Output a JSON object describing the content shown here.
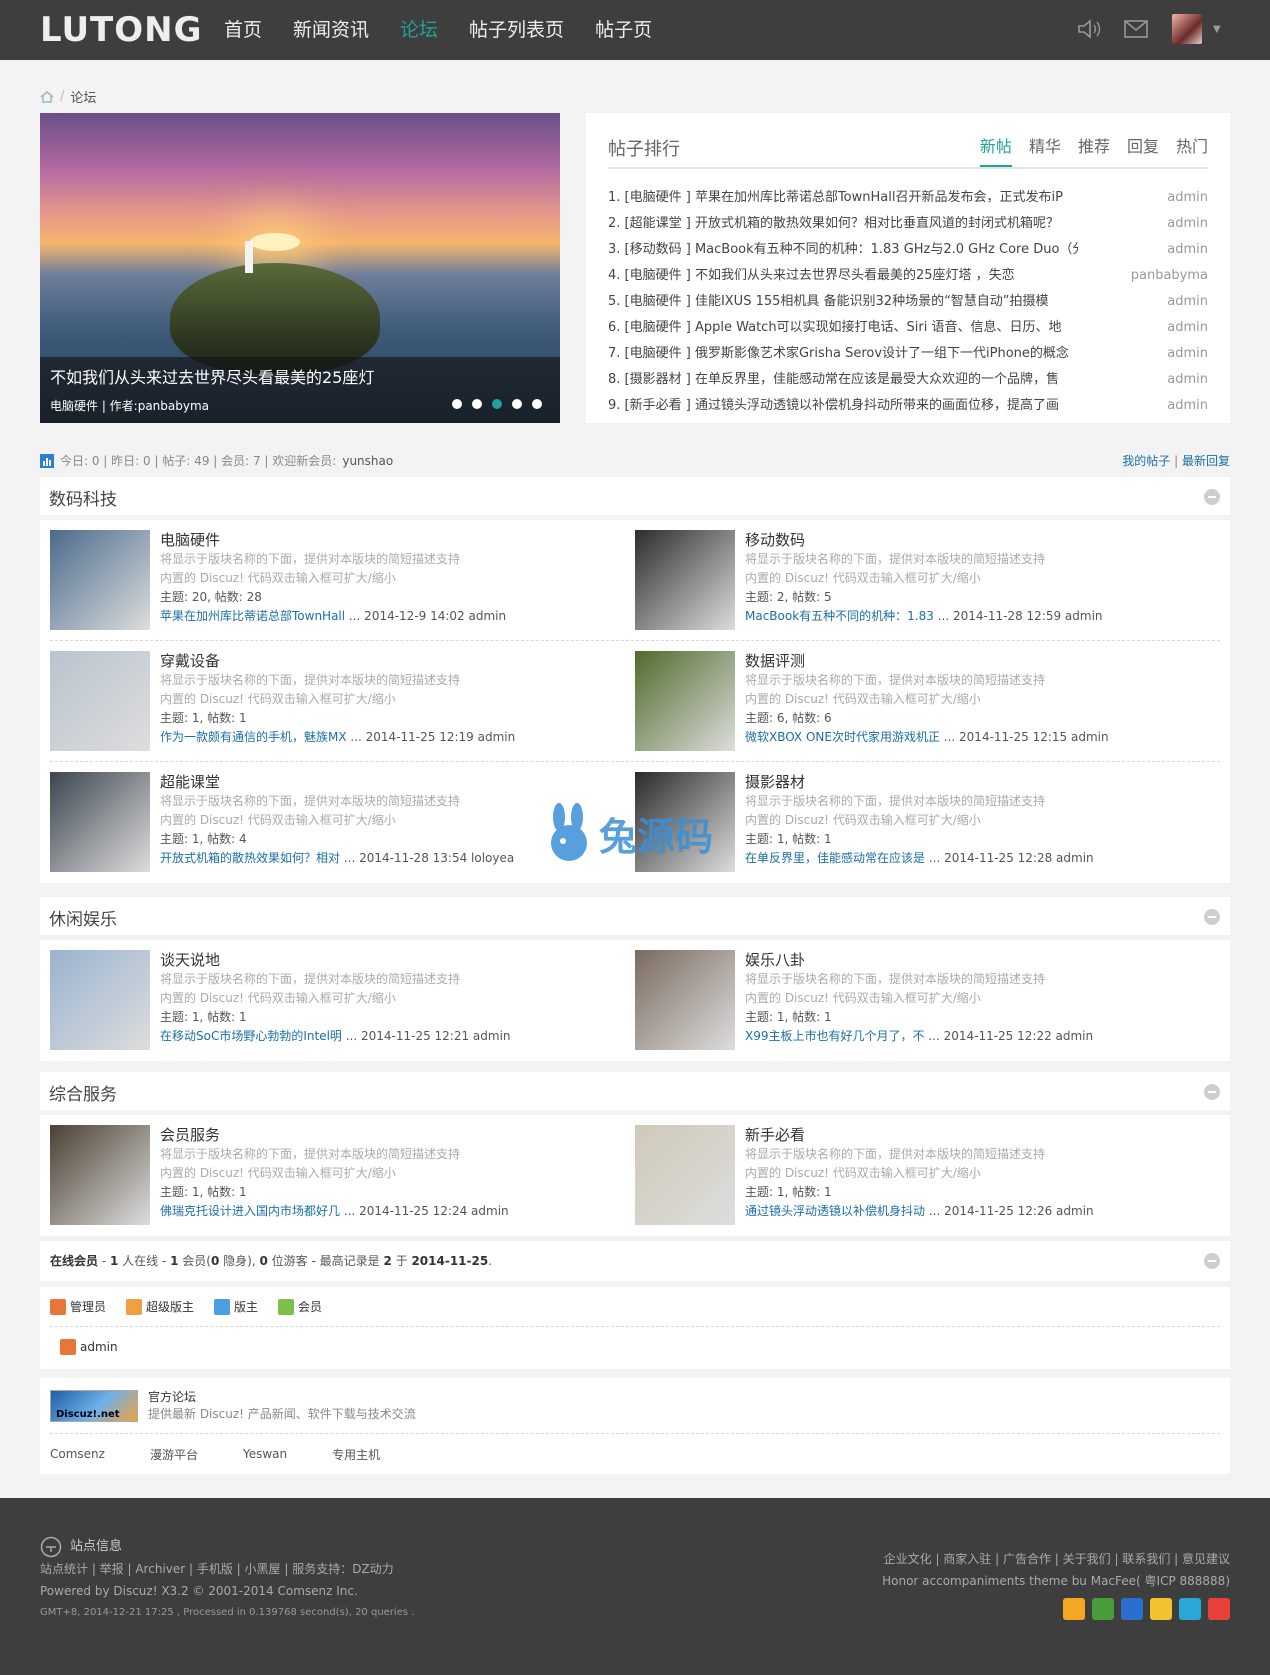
{
  "header": {
    "logo": "LUTONG",
    "nav": [
      "首页",
      "新闻资讯",
      "论坛",
      "帖子列表页",
      "帖子页"
    ],
    "active_nav": 2
  },
  "breadcrumb": {
    "current": "论坛"
  },
  "slider": {
    "caption_title": "不如我们从头来过去世界尽头看最美的25座灯",
    "caption_meta": "电脑硬件 | 作者:panbabyma",
    "dots": 5,
    "active_dot": 2
  },
  "ranking": {
    "title": "帖子排行",
    "tabs": [
      "新帖",
      "精华",
      "推荐",
      "回复",
      "热门"
    ],
    "items": [
      {
        "text": "1.  [电脑硬件 ] 苹果在加州库比蒂诺总部TownHall召开新品发布会，正式发布iP",
        "author": "admin"
      },
      {
        "text": "2.  [超能课堂 ] 开放式机箱的散热效果如何？相对比垂直风道的封闭式机箱呢？",
        "author": "admin"
      },
      {
        "text": "3.  [移动数码 ] MacBook有五种不同的机种：1.83 GHz与2.0 GHz Core Duo（分",
        "author": "admin"
      },
      {
        "text": "4.  [电脑硬件 ] 不如我们从头来过去世界尽头看最美的25座灯塔 ，失恋",
        "author": "panbabyma"
      },
      {
        "text": "5.  [电脑硬件 ] 佳能IXUS 155相机具 备能识别32种场景的“智慧自动”拍摄模",
        "author": "admin"
      },
      {
        "text": "6.  [电脑硬件 ] Apple Watch可以实现如接打电话、Siri 语音、信息、日历、地",
        "author": "admin"
      },
      {
        "text": "7.  [电脑硬件 ] 俄罗斯影像艺术家Grisha Serov设计了一组下一代iPhone的概念",
        "author": "admin"
      },
      {
        "text": "8.  [摄影器材 ] 在单反界里，佳能感动常在应该是最受大众欢迎的一个品牌，售",
        "author": "admin"
      },
      {
        "text": "9.  [新手必看 ] 通过镜头浮动透镜以补偿机身抖动所带来的画面位移，提高了画",
        "author": "admin"
      }
    ]
  },
  "stats": {
    "text": "今日: 0 | 昨日: 0 | 帖子: 49 | 会员: 7 | 欢迎新会员:",
    "new_member": "yunshao",
    "my_posts": "我的帖子",
    "latest_replies": "最新回复"
  },
  "sections": [
    {
      "title": "数码科技",
      "forums": [
        {
          "name": "电脑硬件",
          "desc1": "将显示于版块名称的下面，提供对本版块的简短描述支持",
          "desc2": "内置的 Discuz! 代码双击输入框可扩大/缩小",
          "counts": "主题: 20, 帖数: 28",
          "last_link": "苹果在加州库比蒂诺总部TownHall",
          "last_meta": " ... 2014-12-9 14:02 admin",
          "color": "#4a6b8c"
        },
        {
          "name": "移动数码",
          "desc1": "将显示于版块名称的下面，提供对本版块的简短描述支持",
          "desc2": "内置的 Discuz! 代码双击输入框可扩大/缩小",
          "counts": "主题: 2, 帖数: 5",
          "last_link": "MacBook有五种不同的机种：1.83",
          "last_meta": " ... 2014-11-28 12:59 admin",
          "color": "#2c2c2c"
        },
        {
          "name": "穿戴设备",
          "desc1": "将显示于版块名称的下面，提供对本版块的简短描述支持",
          "desc2": "内置的 Discuz! 代码双击输入框可扩大/缩小",
          "counts": "主题: 1, 帖数: 1",
          "last_link": "作为一款颇有通信的手机，魅族MX",
          "last_meta": " ... 2014-11-25 12:19 admin",
          "color": "#b9c4cf"
        },
        {
          "name": "数据评测",
          "desc1": "将显示于版块名称的下面，提供对本版块的简短描述支持",
          "desc2": "内置的 Discuz! 代码双击输入框可扩大/缩小",
          "counts": "主题: 6, 帖数: 6",
          "last_link": "微软XBOX ONE次时代家用游戏机正",
          "last_meta": " ... 2014-11-25 12:15 admin",
          "color": "#4f6b2a"
        },
        {
          "name": "超能课堂",
          "desc1": "将显示于版块名称的下面，提供对本版块的简短描述支持",
          "desc2": "内置的 Discuz! 代码双击输入框可扩大/缩小",
          "counts": "主题: 1, 帖数: 4",
          "last_link": "开放式机箱的散热效果如何？相对",
          "last_meta": " ... 2014-11-28 13:54 loloyea",
          "color": "#3c4550"
        },
        {
          "name": "摄影器材",
          "desc1": "将显示于版块名称的下面，提供对本版块的简短描述支持",
          "desc2": "内置的 Discuz! 代码双击输入框可扩大/缩小",
          "counts": "主题: 1, 帖数: 1",
          "last_link": "在单反界里，佳能感动常在应该是",
          "last_meta": " ... 2014-11-25 12:28 admin",
          "color": "#2a2a2a"
        }
      ]
    },
    {
      "title": "休闲娱乐",
      "forums": [
        {
          "name": "谈天说地",
          "desc1": "将显示于版块名称的下面，提供对本版块的简短描述支持",
          "desc2": "内置的 Discuz! 代码双击输入框可扩大/缩小",
          "counts": "主题: 1, 帖数: 1",
          "last_link": "在移动SoC市场野心勃勃的Intel明",
          "last_meta": " ... 2014-11-25 12:21 admin",
          "color": "#9ab3cf"
        },
        {
          "name": "娱乐八卦",
          "desc1": "将显示于版块名称的下面，提供对本版块的简短描述支持",
          "desc2": "内置的 Discuz! 代码双击输入框可扩大/缩小",
          "counts": "主题: 1, 帖数: 1",
          "last_link": "X99主板上市也有好几个月了，不",
          "last_meta": " ... 2014-11-25 12:22 admin",
          "color": "#7a6a5e"
        }
      ]
    },
    {
      "title": "综合服务",
      "forums": [
        {
          "name": "会员服务",
          "desc1": "将显示于版块名称的下面，提供对本版块的简短描述支持",
          "desc2": "内置的 Discuz! 代码双击输入框可扩大/缩小",
          "counts": "主题: 1, 帖数: 1",
          "last_link": "佛瑞克托设计进入国内市场都好几",
          "last_meta": " ... 2014-11-25 12:24 admin",
          "color": "#4b4032"
        },
        {
          "name": "新手必看",
          "desc1": "将显示于版块名称的下面，提供对本版块的简短描述支持",
          "desc2": "内置的 Discuz! 代码双击输入框可扩大/缩小",
          "counts": "主题: 1, 帖数: 1",
          "last_link": "通过镜头浮动透镜以补偿机身抖动",
          "last_meta": " ... 2014-11-25 12:26 admin",
          "color": "#cfc9b8"
        }
      ]
    }
  ],
  "online": {
    "label": "在线会员",
    "text1": " - ",
    "n_online": "1",
    "t2": " 人在线 - ",
    "n_members": "1",
    "t3": " 会员(",
    "n_hidden": "0",
    "t4": " 隐身), ",
    "n_guests": "0",
    "t5": " 位游客 - 最高记录是 ",
    "record": "2",
    "t6": " 于 ",
    "record_date": "2014-11-25",
    "t7": "."
  },
  "legend": {
    "items": [
      {
        "label": "管理员",
        "color": "#e8763a"
      },
      {
        "label": "超级版主",
        "color": "#f0a040"
      },
      {
        "label": "版主",
        "color": "#4aa0e0"
      },
      {
        "label": "会员",
        "color": "#7cc04a"
      }
    ],
    "online_user": "admin"
  },
  "links": {
    "logo_text": "Discuz!.net",
    "name": "官方论坛",
    "desc": "提供最新 Discuz! 产品新闻、软件下载与技术交流",
    "text_links": [
      "Comsenz",
      "漫游平台",
      "Yeswan",
      "专用主机"
    ]
  },
  "footer": {
    "site_info": "站点信息",
    "line1": "站点统计 |  举报 |  Archiver |  手机版 |  小黑屋  |  服务支持：DZ动力",
    "line2": "Powered by Discuz! X3.2 © 2001-2014 Comsenz Inc.",
    "line3": "GMT+8, 2014-12-21 17:25 , Processed in 0.139768 second(s), 20 queries .",
    "right1": "企业文化 | 商家入驻 | 广告合作 | 关于我们 | 联系我们 | 意见建议",
    "right2": "Honor accompaniments theme bu MacFee( 粤ICP 888888)",
    "sns_colors": [
      "#f5a623",
      "#4a9b3a",
      "#2a6fd0",
      "#f2c230",
      "#29a7d8",
      "#e8403a"
    ]
  }
}
